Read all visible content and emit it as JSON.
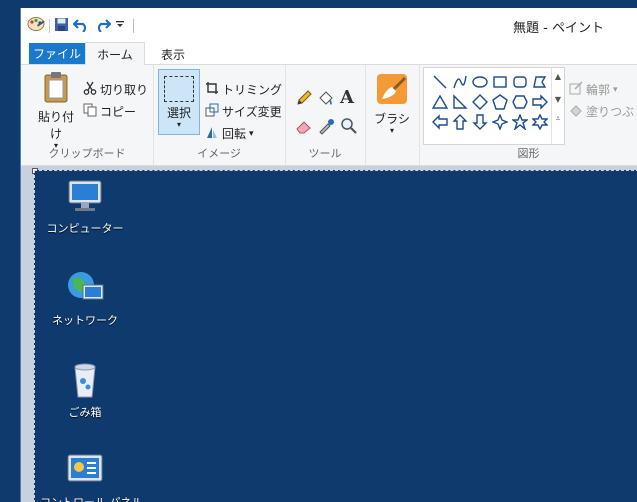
{
  "window": {
    "title": "無題 - ペイント"
  },
  "quick_access": {
    "icons": [
      "paint-app-icon",
      "save-icon",
      "undo-icon",
      "redo-icon",
      "customize-dropdown-icon"
    ]
  },
  "tabs": {
    "file": "ファイル",
    "home": "ホーム",
    "view": "表示"
  },
  "ribbon": {
    "clipboard": {
      "paste": "貼り付け",
      "cut": "切り取り",
      "copy": "コピー",
      "label": "クリップボード"
    },
    "image": {
      "select": "選択",
      "crop": "トリミング",
      "resize": "サイズ変更",
      "rotate": "回転",
      "label": "イメージ"
    },
    "tools": {
      "label": "ツール",
      "text_glyph": "A"
    },
    "brushes": {
      "label": "ブラシ"
    },
    "shapes": {
      "outline": "輪郭",
      "fill": "塗りつぶし",
      "label": "図形"
    }
  },
  "desktop": {
    "items": [
      {
        "label": "コンピューター"
      },
      {
        "label": "ネットワーク"
      },
      {
        "label": "ごみ箱"
      },
      {
        "label": "コントロール パネル"
      }
    ]
  },
  "colors": {
    "accent": "#1979ca",
    "desktop_bg": "#0e3a6e",
    "ribbon_bg": "#f5f6f7"
  }
}
